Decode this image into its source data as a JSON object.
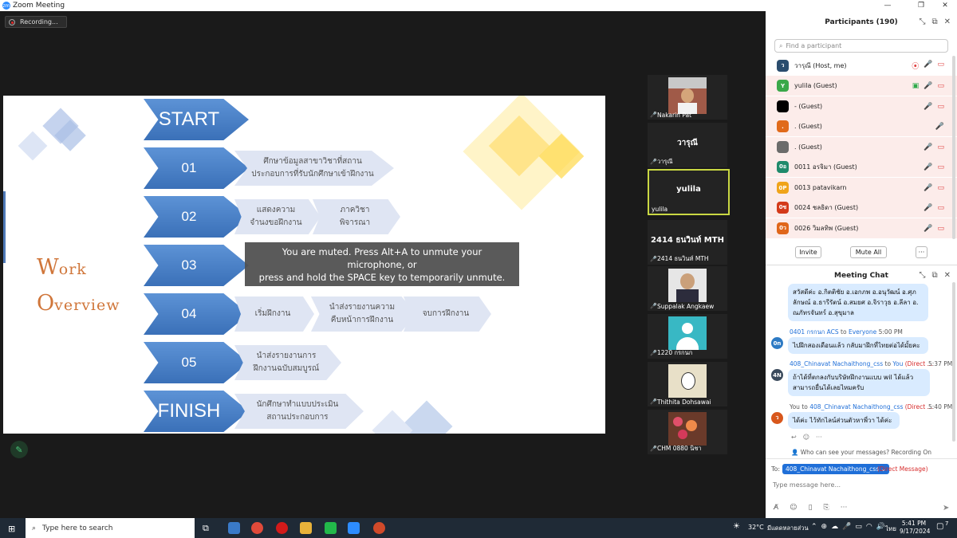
{
  "window": {
    "title": "Zoom Meeting",
    "min": "—",
    "max": "❐",
    "close": "✕"
  },
  "recording": {
    "label": "Recording..."
  },
  "slide": {
    "work_cap": "W",
    "work_rest": "ork",
    "overview_cap": "O",
    "overview_rest": "verview",
    "steps": [
      {
        "label": "START",
        "lines": []
      },
      {
        "label": "01",
        "lines": [
          "ศึกษาข้อมูลสาขาวิชาที่สถาน",
          "ประกอบการที่รับนักศึกษาเข้าฝึกงาน"
        ]
      },
      {
        "label": "02",
        "lines": [
          "แสดงความ",
          "จำนงขอฝึกงาน"
        ],
        "extra": [
          "ภาควิชา",
          "พิจารณา"
        ]
      },
      {
        "label": "03",
        "lines": []
      },
      {
        "label": "04",
        "lines": [
          "เริ่มฝึกงาน"
        ],
        "extra": [
          "นำส่งรายงานความ",
          "คืบหน้าการฝึกงาน"
        ],
        "extra2": [
          "จบการฝึกงาน"
        ]
      },
      {
        "label": "05",
        "lines": [
          "นำส่งรายงานการ",
          "ฝึกงานฉบับสมบูรณ์"
        ]
      },
      {
        "label": "FINISH",
        "lines": [
          "นักศึกษาทำแบบประเมิน",
          "สถานประกอบการ"
        ]
      }
    ]
  },
  "muted_tip": {
    "line1": "You are muted. Press Alt+A to unmute your microphone, or",
    "line2": "press and hold the SPACE key to temporarily unmute."
  },
  "video_tiles": [
    {
      "name": "Nakarin Pat",
      "big": ""
    },
    {
      "name": "วารุณี",
      "big": "วารุณี"
    },
    {
      "name": "yulila",
      "big": "yulila"
    },
    {
      "name": "2414 ธนวินท์ MTH",
      "big": "2414 ธนวินท์ MTH"
    },
    {
      "name": "Suppalak Angkaew",
      "big": ""
    },
    {
      "name": "1220 กรกนก",
      "big": ""
    },
    {
      "name": "Thithita Dohsawai",
      "big": ""
    },
    {
      "name": "CHM 0880 นิชา",
      "big": ""
    }
  ],
  "participants": {
    "title": "Participants (190)",
    "search_placeholder": "Find a participant",
    "rows": [
      {
        "initial": "ว",
        "name": "วารุณี (Host, me)",
        "color": "#2b4d6e"
      },
      {
        "initial": "Y",
        "name": "yulila (Guest)",
        "color": "#3aa84a"
      },
      {
        "initial": "",
        "name": "- (Guest)",
        "color": "#000000"
      },
      {
        "initial": ".",
        "name": ". (Guest)",
        "color": "#e06a1a"
      },
      {
        "initial": "",
        "name": ". (Guest)",
        "color": "#6b6b6b"
      },
      {
        "initial": "0อ",
        "name": "0011 อรจิมา (Guest)",
        "color": "#1f8a6b"
      },
      {
        "initial": "0P",
        "name": "0013 patavikarn",
        "color": "#f0a41a"
      },
      {
        "initial": "0ช",
        "name": "0024 ชลธิดา (Guest)",
        "color": "#d43a1a"
      },
      {
        "initial": "0ว",
        "name": "0026 วิมลทิพ (Guest)",
        "color": "#e0661a"
      }
    ],
    "invite": "Invite",
    "mute_all": "Mute All",
    "more": "···"
  },
  "chat": {
    "title": "Meeting Chat",
    "first_bubble": [
      "สวัสดีค่ะ อ.กิตติชัย อ.เอกภพ อ.อนุวัฒน์ อ.ศุภ",
      "ลักษณ์ อ.ธารีรัตน์ อ.สมยศ อ.จิราวุธ อ.ลีลา อ.",
      "ณภัทรจันทร์ อ.สุขุมาล"
    ],
    "messages": [
      {
        "avatar": "0n",
        "avcolor": "#2d7ac4",
        "from": "0401 กรกนก ACS",
        "to_word": "to",
        "to": "Everyone",
        "dm": "",
        "time": "5:00 PM",
        "lines": [
          "ไปฝึกสองเดือนแล้ว กลับมาฝึกที่ไทยต่อได้มั้ยคะ"
        ]
      },
      {
        "avatar": "4N",
        "avcolor": "#3b4a5c",
        "from": "408_Chinavat Nachaithong_css",
        "to_word": "to",
        "to": "You",
        "dm": "(Direct ...",
        "time": "5:37 PM",
        "lines": [
          "ถ้าได้ที่ตกลงกับบริษัทฝึกงานแบบ wil ได้แล้ว",
          "สามารถยื่นได้เลยไหมครับ"
        ]
      },
      {
        "avatar": "ว",
        "avcolor": "#d8571c",
        "from": "You",
        "to_word": "to",
        "to": "408_Chinavat Nachaithong_css",
        "dm": "(Direct ...",
        "time": "5:40 PM",
        "lines": [
          "ได้ค่ะ  ไว้ทักไลน์ส่วนตัวหาพี่วา ได้ค่ะ"
        ]
      }
    ],
    "who_can_see": "Who can see your messages? Recording On",
    "to_label": "To:",
    "recipient": "408_Chinavat Nachaithong_css ⌄",
    "direct": "(Direct Message)",
    "input_placeholder": "Type message here..."
  },
  "taskbar": {
    "search": "Type here to search",
    "temp": "32°C",
    "weather": "มีแดดหลายส่วน",
    "lang": "ไทย",
    "time": "5:41 PM",
    "date": "9/17/2024",
    "notif": "7"
  }
}
